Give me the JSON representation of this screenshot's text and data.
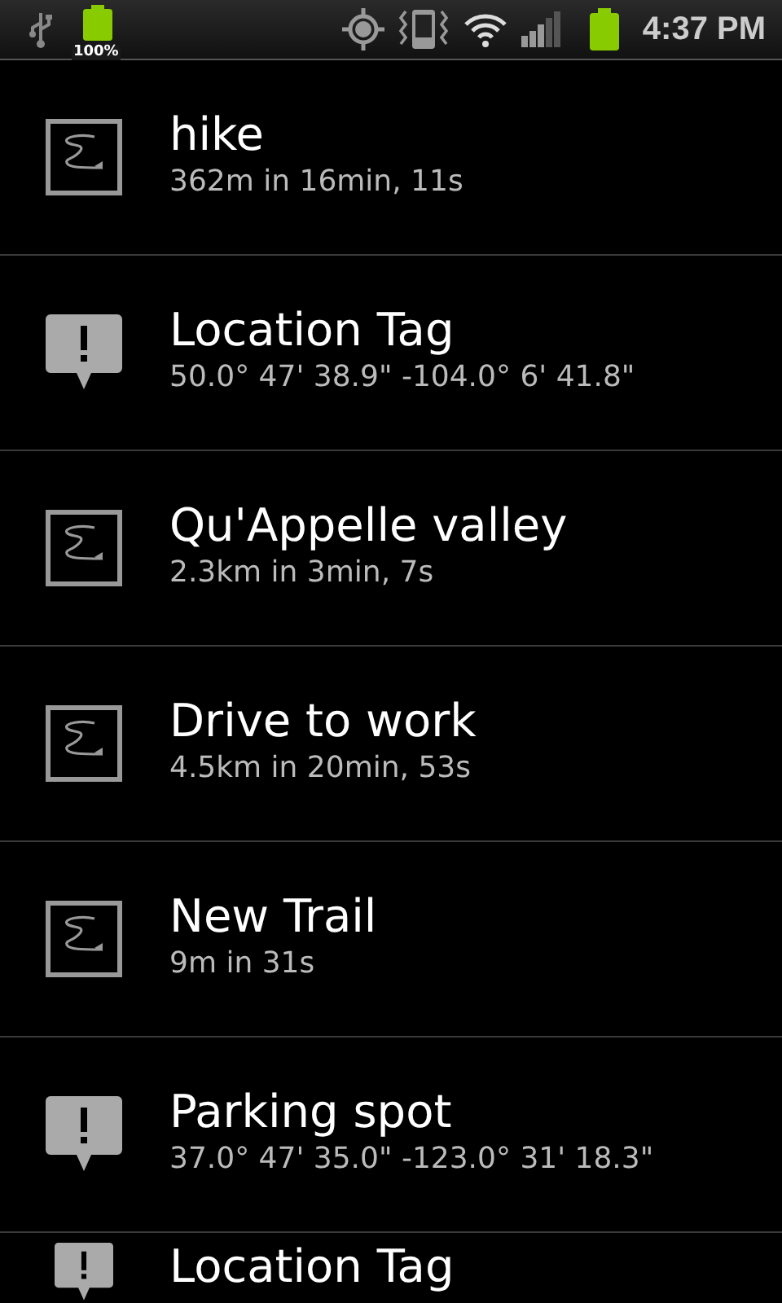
{
  "status_bar": {
    "battery_label": "100%",
    "time": "4:37 PM"
  },
  "items": [
    {
      "kind": "track",
      "title": "hike",
      "subtitle": "362m in 16min, 11s"
    },
    {
      "kind": "tag",
      "title": "Location Tag",
      "subtitle": "50.0° 47' 38.9\" -104.0° 6' 41.8\""
    },
    {
      "kind": "track",
      "title": "Qu'Appelle valley",
      "subtitle": "2.3km in 3min, 7s"
    },
    {
      "kind": "track",
      "title": "Drive to work",
      "subtitle": "4.5km in 20min, 53s"
    },
    {
      "kind": "track",
      "title": "New Trail",
      "subtitle": "9m in 31s"
    },
    {
      "kind": "tag",
      "title": "Parking spot",
      "subtitle": "37.0° 47' 35.0\" -123.0° 31' 18.3\""
    },
    {
      "kind": "tag",
      "title": "Location Tag"
    }
  ]
}
